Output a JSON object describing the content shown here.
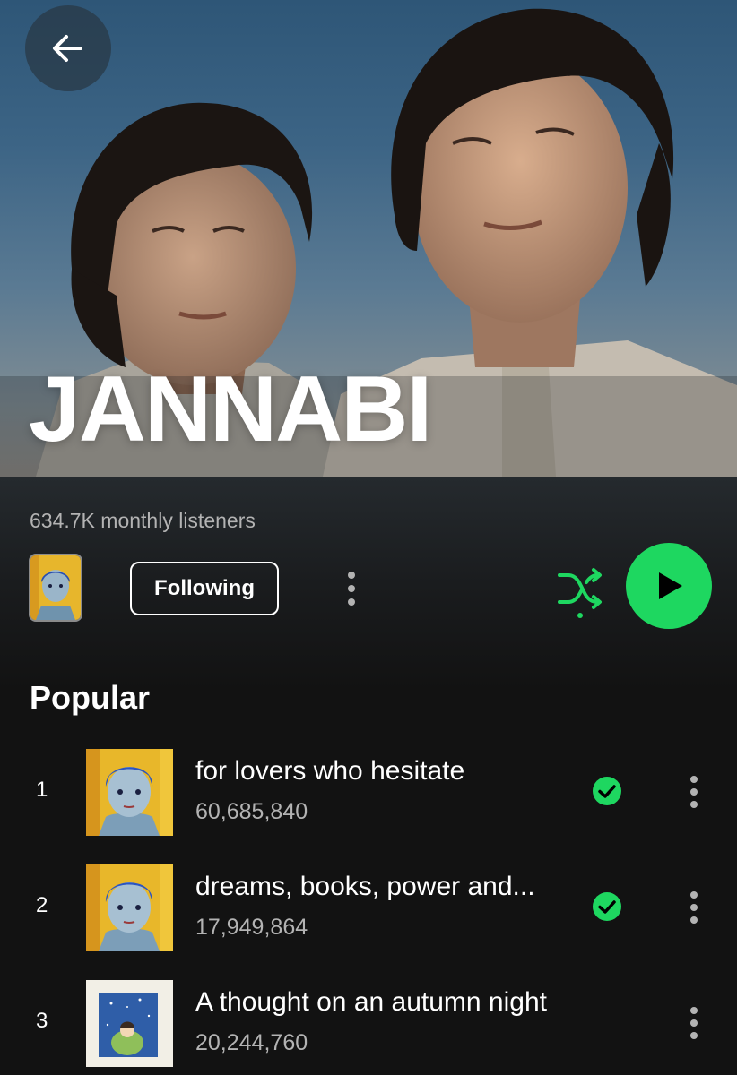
{
  "artist": {
    "name": "JANNABI",
    "monthly_listeners": "634.7K monthly listeners"
  },
  "actions": {
    "follow_label": "Following"
  },
  "popular": {
    "title": "Popular",
    "tracks": [
      {
        "rank": "1",
        "title": "for lovers who hesitate",
        "plays": "60,685,840",
        "saved": true
      },
      {
        "rank": "2",
        "title": "dreams, books, power and...",
        "plays": "17,949,864",
        "saved": true
      },
      {
        "rank": "3",
        "title": "A thought on an autumn night",
        "plays": "20,244,760",
        "saved": false
      }
    ]
  },
  "colors": {
    "accent": "#1ed760",
    "background": "#121212",
    "secondary_text": "#b3b3b3"
  },
  "icons": {
    "back": "arrow-left-icon",
    "more": "more-vertical-icon",
    "shuffle": "shuffle-icon",
    "play": "play-icon",
    "saved": "check-circle-icon"
  }
}
